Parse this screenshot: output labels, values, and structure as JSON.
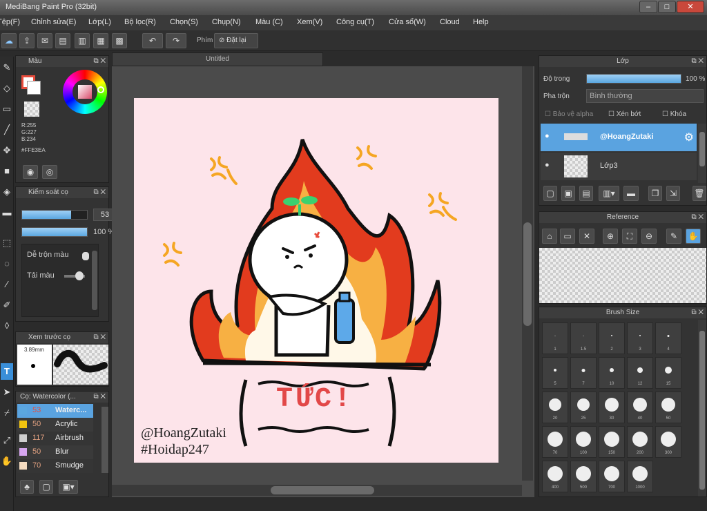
{
  "window": {
    "title": "MediBang Paint Pro (32bit)"
  },
  "menu": [
    "Tệp(F)",
    "Chỉnh sửa(E)",
    "Lớp(L)",
    "Bộ lọc(R)",
    "Chọn(S)",
    "Chụp(N)",
    "Màu (C)",
    "Xem(V)",
    "Công cụ(T)",
    "Cửa sổ(W)",
    "Cloud",
    "Help"
  ],
  "toolbar": {
    "key_label": "Phím",
    "reset_label": "Đặt lại"
  },
  "color_panel": {
    "title": "Màu",
    "r": "R:255",
    "g": "G:227",
    "b": "B:234",
    "hex": "#FFE3EA",
    "primary": "#FFE3EA",
    "accent": "#e74c3c"
  },
  "brush_control": {
    "title": "Kiểm soát cọ",
    "size": "53",
    "opacity": "100 %",
    "blend_label": "Dễ trộn màu",
    "reload_label": "Tải màu"
  },
  "brush_preview": {
    "title": "Xem trước cọ",
    "size": "3.89mm"
  },
  "brush_list": {
    "title": "Cọ: Watercolor (...",
    "items": [
      {
        "size": "53",
        "name": "Waterc...",
        "color": "#5ba7e0",
        "selected": true
      },
      {
        "size": "50",
        "name": "Acrylic",
        "color": "#f1c40f"
      },
      {
        "size": "117",
        "name": "Airbrush",
        "color": "#cfcfcf"
      },
      {
        "size": "50",
        "name": "Blur",
        "color": "#d7a6f0"
      },
      {
        "size": "70",
        "name": "Smudge",
        "color": "#f5dcc0"
      }
    ]
  },
  "canvas": {
    "tab_title": "Untitled",
    "shout_text": "TỨC!",
    "signature": "@HoangZutaki",
    "hashtag": "#Hoidap247"
  },
  "layer_panel": {
    "title": "Lớp",
    "opacity_label": "Độ trong",
    "opacity_value": "100 %",
    "blend_label": "Pha trộn",
    "blend_value": "Bình thường",
    "protect_alpha": "Bảo vệ alpha",
    "clipping": "Xén bớt",
    "lock": "Khóa",
    "layers": [
      {
        "name": "@HoangZutaki",
        "selected": true
      },
      {
        "name": "Lớp3",
        "selected": false
      }
    ]
  },
  "reference_panel": {
    "title": "Reference"
  },
  "brush_size_panel": {
    "title": "Brush Size",
    "sizes": [
      "1",
      "1.5",
      "2",
      "3",
      "4",
      "5",
      "7",
      "10",
      "12",
      "15",
      "20",
      "25",
      "30",
      "40",
      "50",
      "70",
      "100",
      "150",
      "200",
      "300",
      "400",
      "500",
      "700",
      "1000"
    ]
  }
}
